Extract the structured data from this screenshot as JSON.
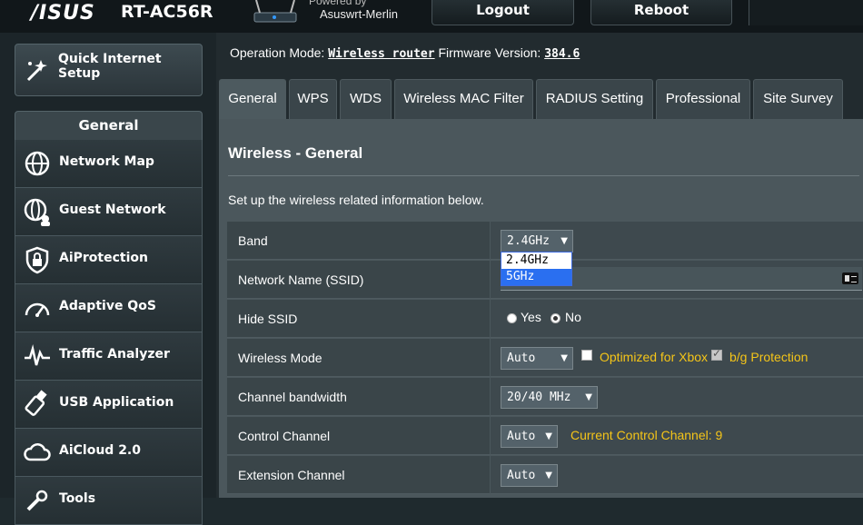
{
  "header": {
    "brand": "/ISUS",
    "model": "RT-AC56R",
    "powered_by": "Powered by",
    "firmware_brand": "Asuswrt-Merlin",
    "logout_label": "Logout",
    "reboot_label": "Reboot"
  },
  "sidebar": {
    "quick_setup_label": "Quick Internet Setup",
    "section_title": "General",
    "items": [
      {
        "label": "Network Map",
        "icon": "globe-icon"
      },
      {
        "label": "Guest Network",
        "icon": "guest-globe-icon"
      },
      {
        "label": "AiProtection",
        "icon": "shield-lock-icon"
      },
      {
        "label": "Adaptive QoS",
        "icon": "speedometer-icon"
      },
      {
        "label": "Traffic Analyzer",
        "icon": "pulse-icon"
      },
      {
        "label": "USB Application",
        "icon": "usb-icon"
      },
      {
        "label": "AiCloud 2.0",
        "icon": "cloud-icon"
      },
      {
        "label": "Tools",
        "icon": "tools-icon"
      }
    ]
  },
  "status": {
    "operation_mode_label": "Operation Mode:",
    "operation_mode_value": "Wireless router",
    "firmware_label": "Firmware Version:",
    "firmware_value": "384.6"
  },
  "tabs": [
    {
      "label": "General",
      "active": true
    },
    {
      "label": "WPS"
    },
    {
      "label": "WDS"
    },
    {
      "label": "Wireless MAC Filter"
    },
    {
      "label": "RADIUS Setting"
    },
    {
      "label": "Professional"
    },
    {
      "label": "Site Survey"
    }
  ],
  "panel": {
    "title": "Wireless - General",
    "description": "Set up the wireless related information below."
  },
  "form": {
    "band": {
      "label": "Band",
      "value": "2.4GHz",
      "options": [
        "2.4GHz",
        "5GHz"
      ],
      "highlighted": "5GHz"
    },
    "ssid": {
      "label": "Network Name (SSID)",
      "value": ""
    },
    "hide_ssid": {
      "label": "Hide SSID",
      "yes": "Yes",
      "no": "No",
      "selected": "No"
    },
    "wireless_mode": {
      "label": "Wireless Mode",
      "value": "Auto",
      "xbox_label": "Optimized for Xbox",
      "xbox_checked": false,
      "bg_label": "b/g Protection",
      "bg_checked": true
    },
    "channel_bandwidth": {
      "label": "Channel bandwidth",
      "value": "20/40 MHz"
    },
    "control_channel": {
      "label": "Control Channel",
      "value": "Auto",
      "current": "Current Control Channel: 9"
    },
    "extension_channel": {
      "label": "Extension Channel",
      "value": "Auto"
    }
  },
  "colors": {
    "accent_yellow": "#f5c518",
    "dropdown_highlight": "#2a6ff0"
  }
}
